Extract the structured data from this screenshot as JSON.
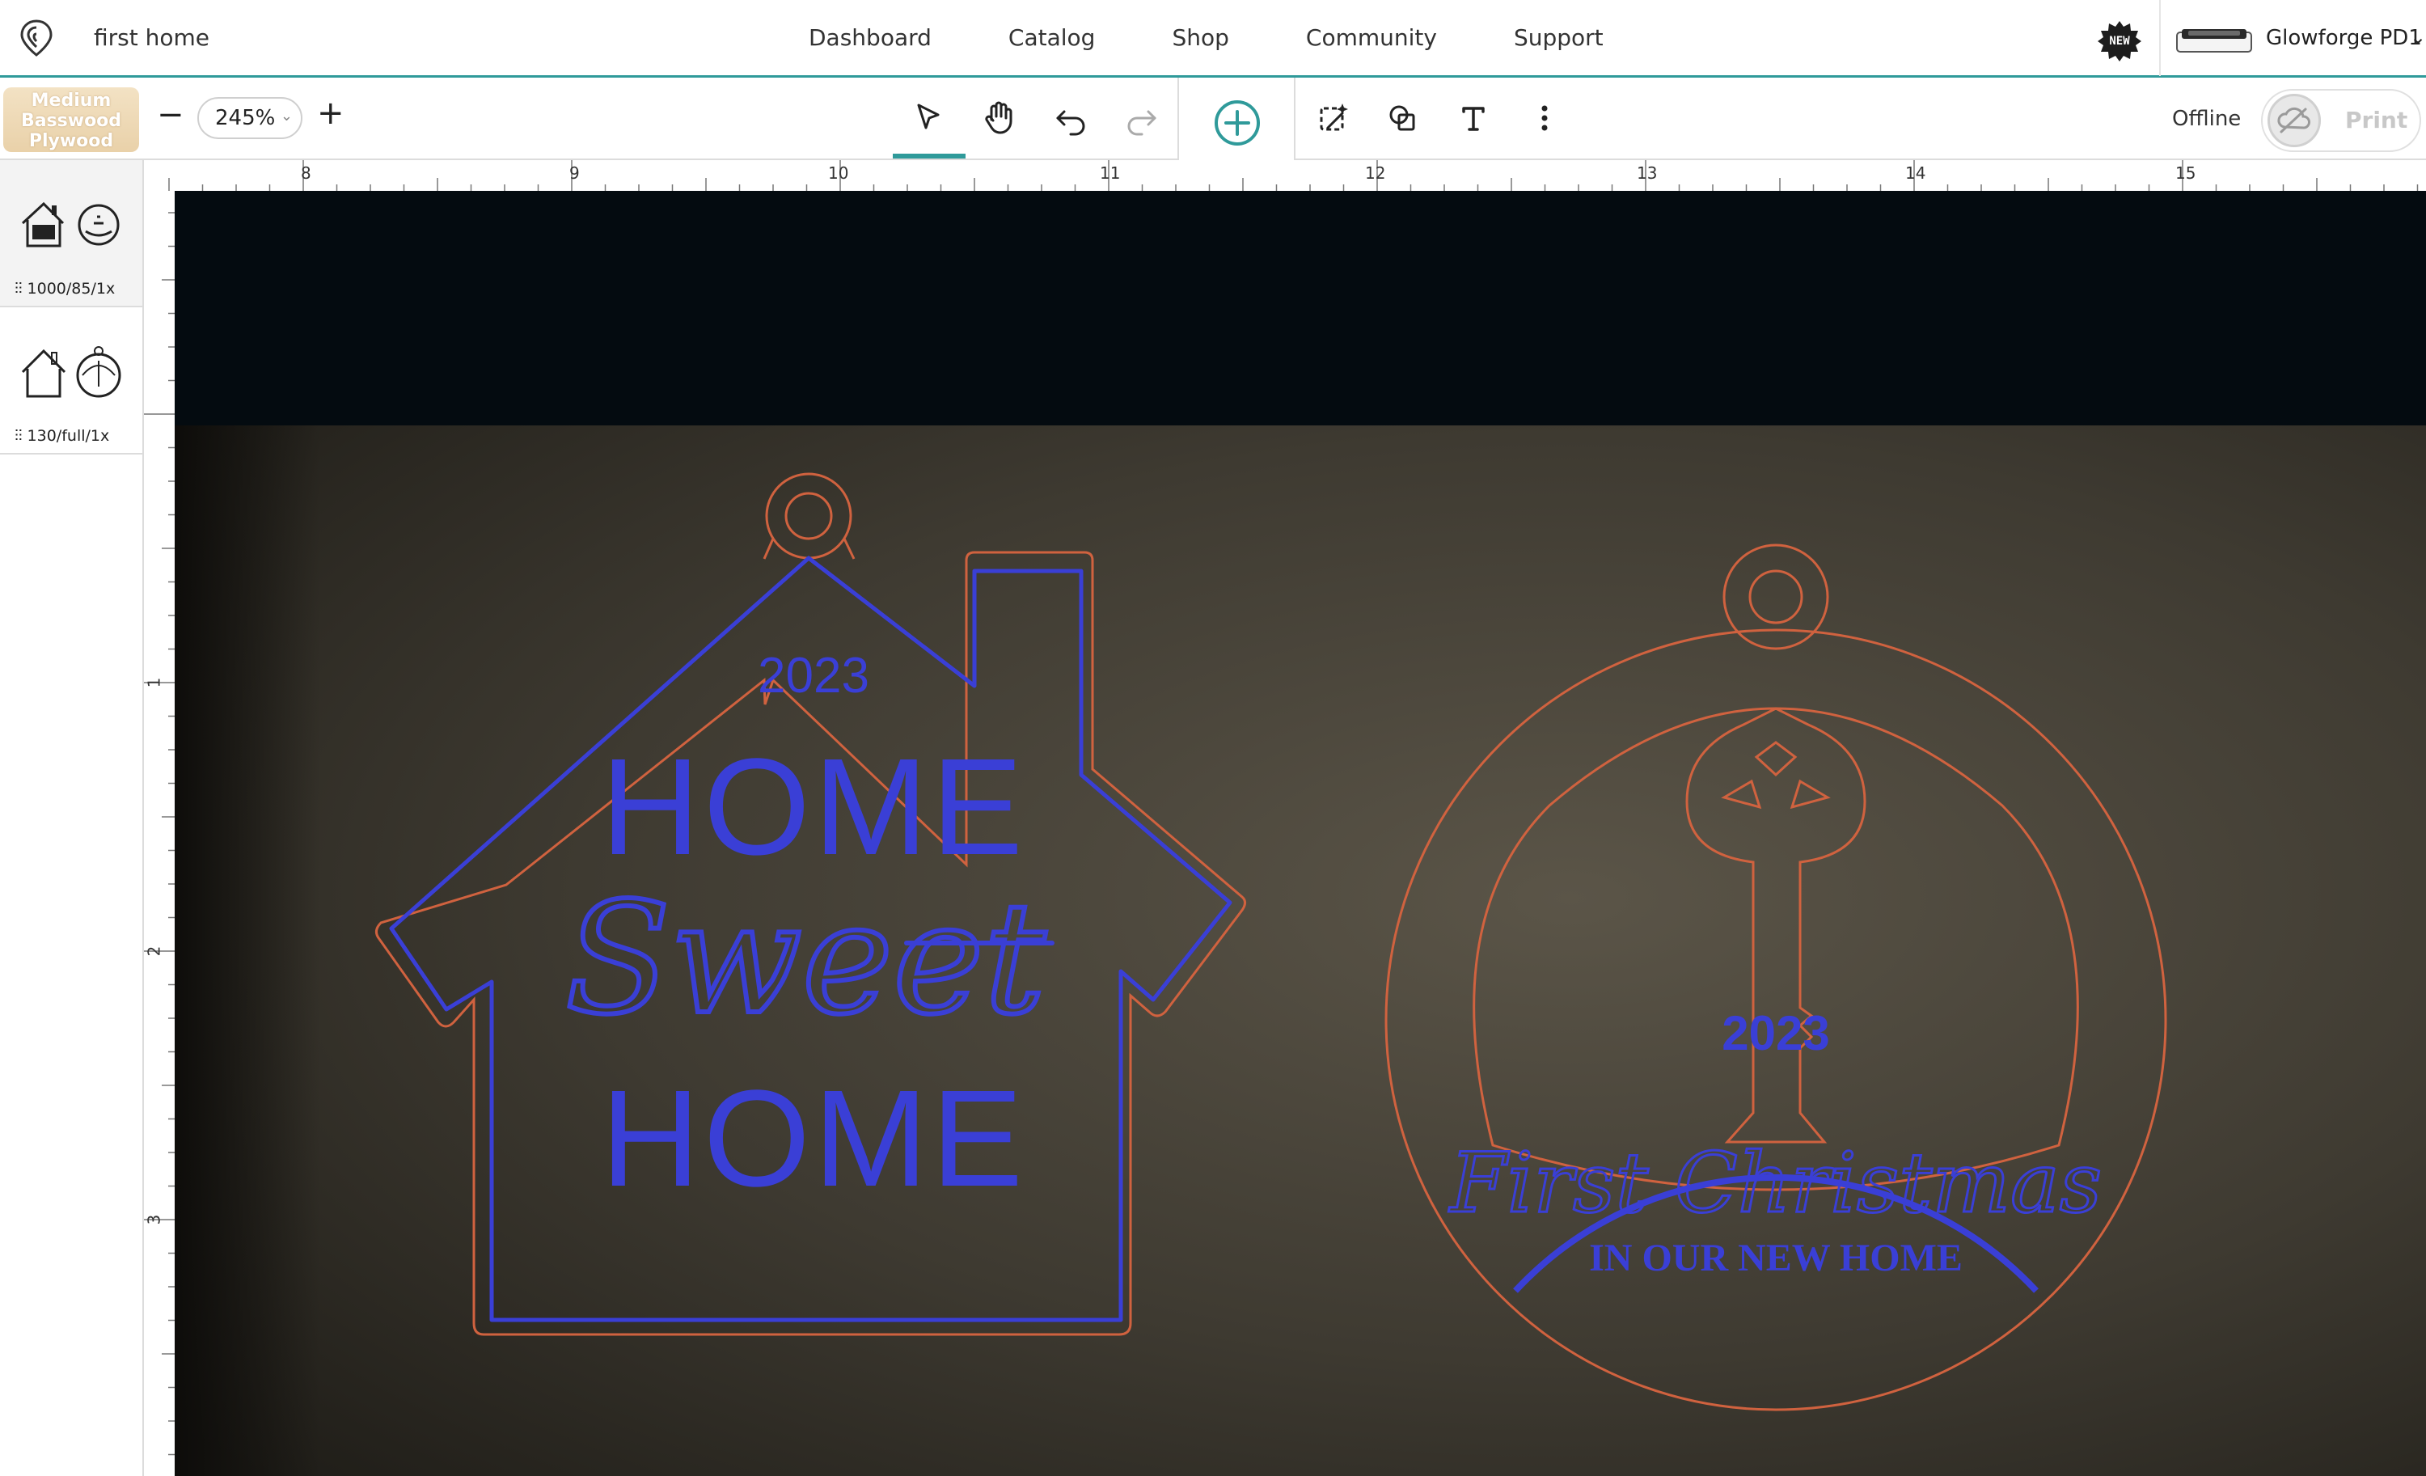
{
  "project": {
    "title": "first home"
  },
  "nav": {
    "links": [
      "Dashboard",
      "Catalog",
      "Shop",
      "Community",
      "Support"
    ],
    "new_badge": "NEW",
    "machine_name": "Glowforge PD1",
    "machine_chevron": "⌄"
  },
  "toolbar": {
    "material": "Medium Basswood Plywood",
    "zoom_minus": "−",
    "zoom_value": "245%",
    "zoom_plus": "+",
    "tools": [
      "select-arrow-icon",
      "hand-pan-icon",
      "undo-icon",
      "redo-icon",
      "add-circle-icon",
      "magic-trace-icon",
      "shapes-icon",
      "text-tool-icon",
      "more-vertical-icon"
    ],
    "status": "Offline",
    "print_label": "Print"
  },
  "steps": [
    {
      "setting": "1000/85/1x",
      "active": true
    },
    {
      "setting": "130/full/1x",
      "active": false
    }
  ],
  "rulers": {
    "top": [
      "8",
      "9",
      "10",
      "11",
      "12",
      "13",
      "14",
      "15"
    ],
    "left": [
      "1",
      "2",
      "3"
    ]
  },
  "design": {
    "house": {
      "year": "2023",
      "line1": "HOME",
      "line2": "Sweet",
      "line3": "HOME"
    },
    "ornament": {
      "year": "2023",
      "script": "First Christmas",
      "subtitle": "IN OUR NEW HOME"
    }
  },
  "colors": {
    "accent": "#2f9a9a",
    "cut_line": "#d0623f",
    "engrave_line": "#3a3fd6",
    "canvas_bg": "#040b10"
  }
}
